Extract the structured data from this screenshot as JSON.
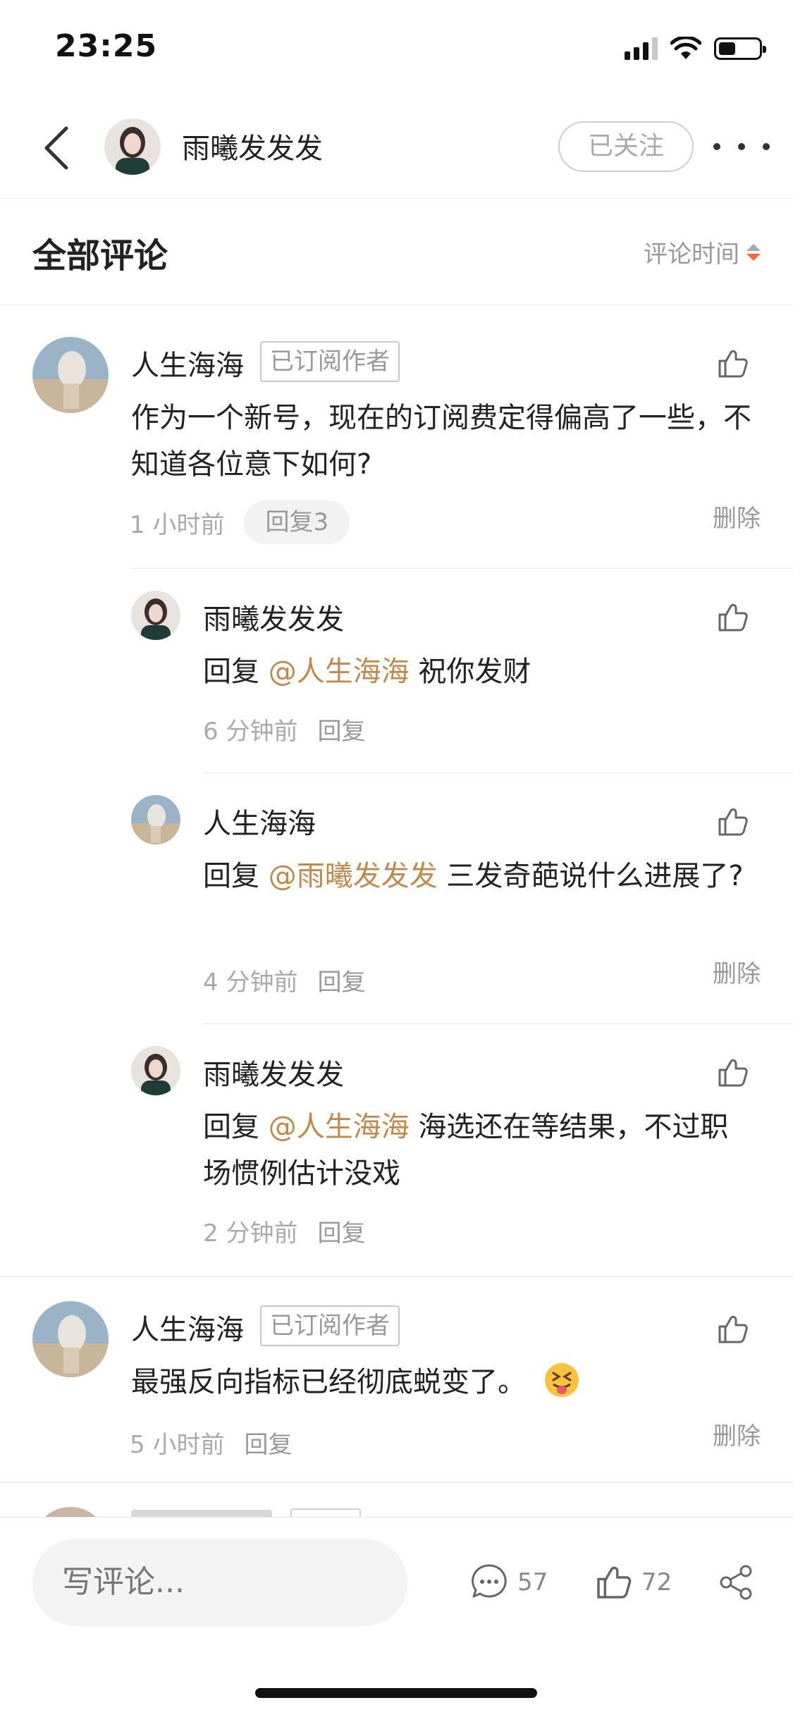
{
  "status_bar": {
    "time": "23:25"
  },
  "header": {
    "title": "雨曦发发发",
    "follow_label": "已关注"
  },
  "section": {
    "title": "全部评论",
    "sort_label": "评论时间"
  },
  "comments": [
    {
      "author": "人生海海",
      "badge": "已订阅作者",
      "text": "作为一个新号，现在的订阅费定得偏高了一些，不知道各位意下如何?",
      "time": "1 小时前",
      "reply_count": "回复3",
      "delete_label": "删除",
      "replies": [
        {
          "author": "雨曦发发发",
          "prefix": "回复",
          "mention": "@人生海海",
          "text": " 祝你发财",
          "time": "6 分钟前",
          "reply_label": "回复"
        },
        {
          "author": "人生海海",
          "prefix": "回复",
          "mention": "@雨曦发发发",
          "text": " 三发奇葩说什么进展了?",
          "time": "4 分钟前",
          "reply_label": "回复",
          "delete_label": "删除"
        },
        {
          "author": "雨曦发发发",
          "prefix": "回复",
          "mention": "@人生海海",
          "text": " 海选还在等结果，不过职场惯例估计没戏",
          "time": "2 分钟前",
          "reply_label": "回复"
        }
      ]
    },
    {
      "author": "人生海海",
      "badge": "已订阅作者",
      "text": "最强反向指标已经彻底蜕变了。",
      "time": "5 小时前",
      "reply_label": "回复",
      "delete_label": "删除"
    }
  ],
  "bottom_bar": {
    "input_placeholder": "写评论...",
    "comment_count": "57",
    "like_count": "72"
  }
}
